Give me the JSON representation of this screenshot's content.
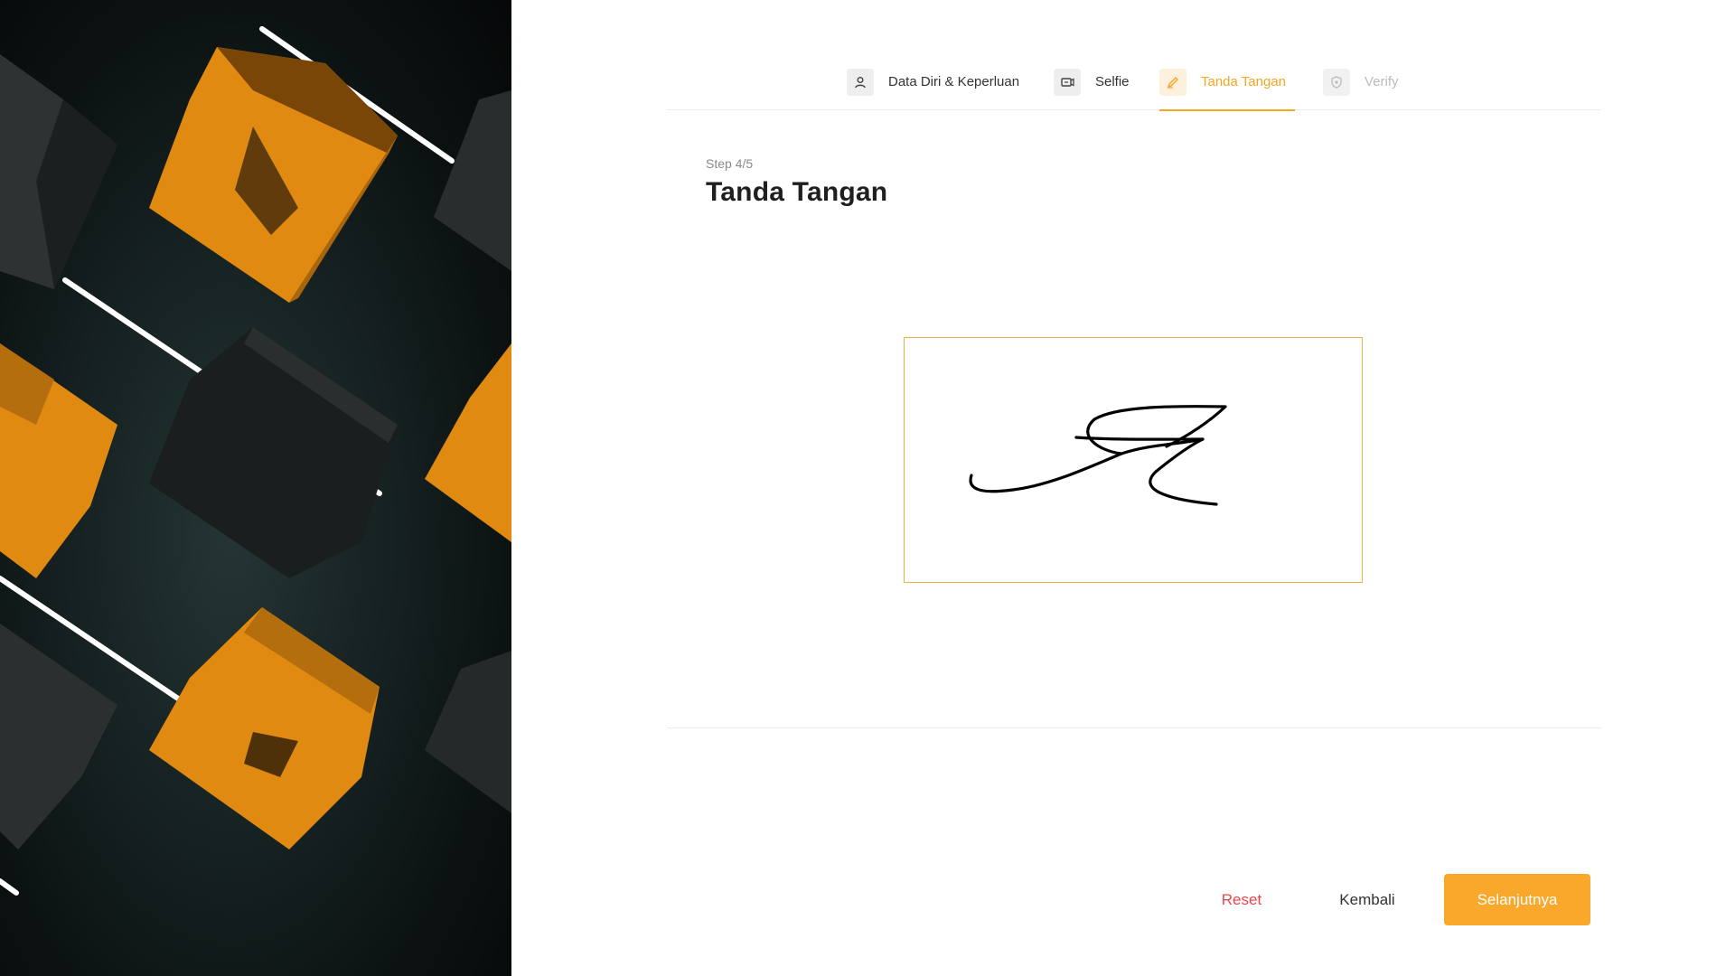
{
  "colors": {
    "accent": "#f5a623",
    "reset": "#e8454f",
    "hero_bg": "#121a1a",
    "cube_orange": "#e08a12"
  },
  "stepper": {
    "steps": [
      {
        "label": "Data Diri & Keperluan",
        "icon": "user-icon",
        "state": "completed"
      },
      {
        "label": "Selfie",
        "icon": "camera-flip-icon",
        "state": "completed"
      },
      {
        "label": "Tanda Tangan",
        "icon": "pen-icon",
        "state": "active"
      },
      {
        "label": "Verify",
        "icon": "shield-icon",
        "state": "disabled"
      }
    ]
  },
  "page": {
    "step_count": "Step 4/5",
    "title": "Tanda Tangan"
  },
  "actions": {
    "reset_label": "Reset",
    "back_label": "Kembali",
    "next_label": "Selanjutnya"
  }
}
